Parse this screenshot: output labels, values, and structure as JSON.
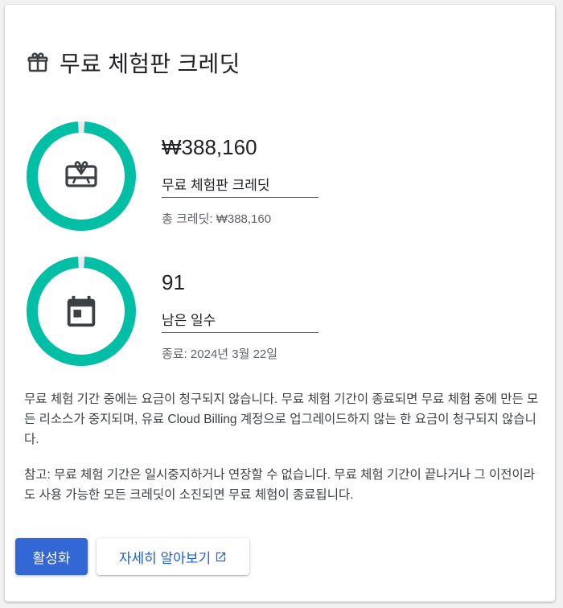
{
  "header": {
    "title": "무료 체험판 크레딧",
    "icon": "gift-icon"
  },
  "credit": {
    "value": "₩388,160",
    "label": "무료 체험판 크레딧",
    "total": "총 크레딧: ₩388,160",
    "remaining_fraction": 0.98,
    "icon": "gift-card-icon"
  },
  "days": {
    "value": "91",
    "label": "남은 일수",
    "end": "종료: 2024년 3월 22일",
    "remaining_fraction": 0.98,
    "icon": "calendar-icon"
  },
  "info": {
    "p1": "무료 체험 기간 중에는 요금이 청구되지 않습니다. 무료 체험 기간이 종료되면 무료 체험 중에 만든 모든 리소스가 중지되며, 유료 Cloud Billing 계정으로 업그레이드하지 않는 한 요금이 청구되지 않습니다.",
    "p2": "참고: 무료 체험 기간은 일시중지하거나 연장할 수 없습니다. 무료 체험 기간이 끝나거나 그 이전이라도 사용 가능한 모든 크레딧이 소진되면 무료 체험이 종료됩니다."
  },
  "actions": {
    "activate_label": "활성화",
    "learn_more_label": "자세히 알아보기"
  },
  "colors": {
    "ring": "#00bfa5",
    "primary": "#3367d6",
    "link": "#1a5fd9",
    "icon": "#3c4043"
  }
}
